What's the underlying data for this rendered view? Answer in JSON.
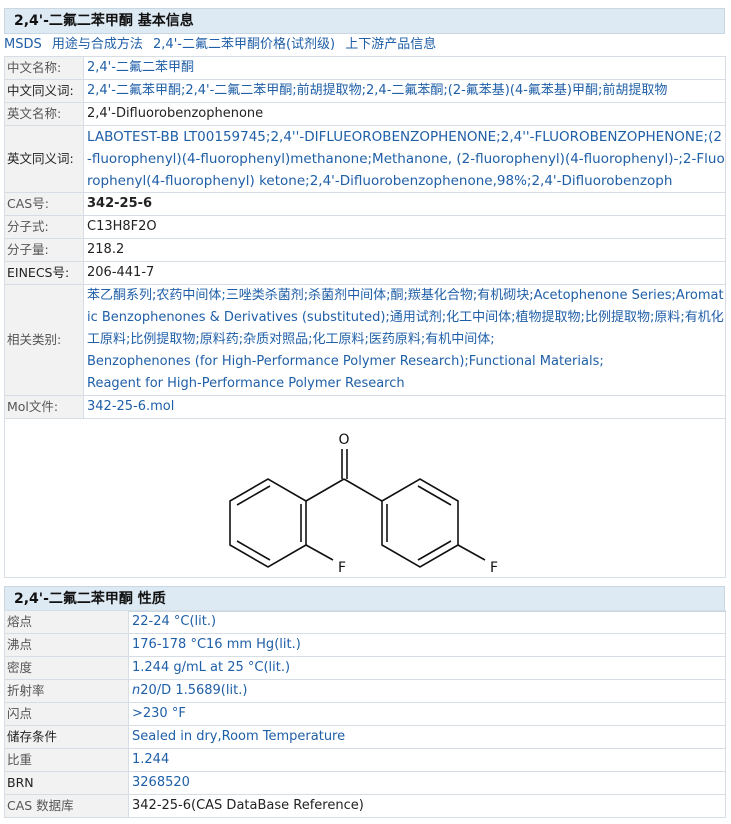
{
  "basic": {
    "title": "2,4'-二氟二苯甲酮 基本信息",
    "sublinks": [
      "MSDS",
      "用途与合成方法",
      "2,4'-二氟二苯甲酮价格(试剂级)",
      "上下游产品信息"
    ],
    "rows": [
      {
        "label": "中文名称:",
        "value": "2,4'-二氟二苯甲酮"
      },
      {
        "label": "中文同义词:",
        "value": "2,4'-二氟苯甲酮;2,4'-二氟二苯甲酮;前胡提取物;2,4-二氟苯酮;(2-氟苯基)(4-氟苯基)甲酮;前胡提取物"
      },
      {
        "label": "英文名称:",
        "value": "2,4'-Difluorobenzophenone"
      },
      {
        "label": "英文同义词:",
        "value": "LABOTEST-BB LT00159745;2,4''-DIFLUEOROBENZOPHENONE;2,4''-FLUOROBENZOPHENONE;(2-fluorophenyl)(4-fluorophenyl)methanone;Methanone, (2-fluorophenyl)(4-fluorophenyl)-;2-Fluorophenyl(4-fluorophenyl) ketone;2,4'-Difluorobenzophenone,98%;2,4'-Difluorobenzoph"
      },
      {
        "label": "CAS号:",
        "value": "342-25-6"
      },
      {
        "label": "分子式:",
        "value": "C13H8F2O"
      },
      {
        "label": "分子量:",
        "value": "218.2"
      },
      {
        "label": "EINECS号:",
        "value": "206-441-7"
      },
      {
        "label": "相关类别:",
        "value": [
          "苯乙酮系列;农药中间体;三唑类杀菌剂;杀菌剂中间体;酮;羰基化合物;有机砌块;Acetophenone Series;Aromatic Benzophenones & Derivatives (substituted);通用试剂;化工中间体;植物提取物;比例提取物;原料;有机化工原料;比例提取物;原料药;杂质对照品;化工原料;医药原料;有机中间体;",
          "Benzophenones (for High-Performance Polymer Research);Functional Materials;",
          "Reagent for High-Performance Polymer Research"
        ]
      },
      {
        "label": "Mol文件:",
        "value": "342-25-6.mol"
      }
    ],
    "structure": {
      "atom_o": "O",
      "atom_f1": "F",
      "atom_f2": "F"
    }
  },
  "props": {
    "title": "2,4'-二氟二苯甲酮 性质",
    "rows": [
      {
        "label": "熔点",
        "value": "22-24 °C(lit.)"
      },
      {
        "label": "沸点",
        "value": "176-178 °C16 mm Hg(lit.)"
      },
      {
        "label": "密度",
        "value": "1.244 g/mL at 25 °C(lit.)"
      },
      {
        "label": "折射率",
        "value_italic": "n",
        "value": "20/D 1.5689(lit.)"
      },
      {
        "label": "闪点",
        "value": ">230 °F"
      },
      {
        "label": "储存条件",
        "value": "Sealed in dry,Room Temperature"
      },
      {
        "label": "比重",
        "value": "1.244"
      },
      {
        "label": "BRN",
        "value": "3268520"
      },
      {
        "label": "CAS 数据库",
        "value": "342-25-6(CAS DataBase Reference)"
      }
    ]
  },
  "colors": {
    "link": "#1f5fa8",
    "header_bg": "#dde9f3",
    "label_bg": "#f2f2f2"
  }
}
